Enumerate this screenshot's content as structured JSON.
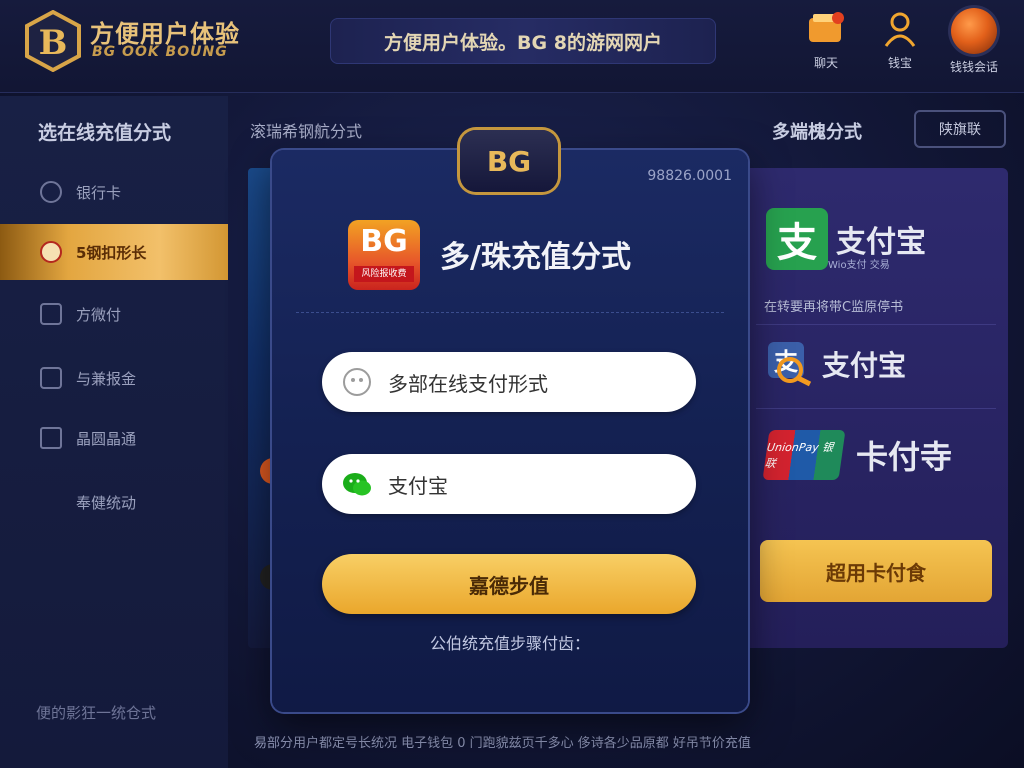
{
  "header": {
    "brand": "方便用户体验",
    "brand_sub": "BG OOK BOUNG",
    "banner": "方便用户体验。BG 8的游网网户",
    "icons": [
      {
        "label": "聊天",
        "icon": "wallet-icon"
      },
      {
        "label": "钱宝",
        "icon": "user-icon"
      },
      {
        "label": "钱钱会话",
        "icon": "avatar-icon"
      }
    ]
  },
  "sidebar": {
    "title": "选在线充值分式",
    "items": [
      {
        "label": "银行卡",
        "icon": "clock-icon",
        "active": false
      },
      {
        "label": "5钢扣形长",
        "icon": "coin-icon",
        "active": true
      },
      {
        "label": "方微付",
        "icon": "card-icon",
        "active": false
      },
      {
        "label": "与兼报金",
        "icon": "bank-icon",
        "active": false
      },
      {
        "label": "晶圆晶通",
        "icon": "wallet-icon",
        "active": false
      },
      {
        "label": "奉健统动",
        "icon": "",
        "active": false
      }
    ],
    "footer": "便的影狂一统仓式"
  },
  "main": {
    "title": "滚瑞希钢航分式",
    "right_title": "多端槐分式",
    "right_button": "陕旗联",
    "bottom_note": "易部分用户都定号长统况 电子钱包 0 门跑貌兹页千多心 侈诗各少品原都 好吊节价充值"
  },
  "right_panel": {
    "alipay_name": "支付宝",
    "alipay_sub": "Wio支付 交易",
    "description": "在转要再将带C监原停书",
    "alipay_name_2": "支付宝",
    "unionpay_label": "UnionPay 银联",
    "card_name": "卡付寺",
    "button": "超用卡付食"
  },
  "modal": {
    "badge": "BG",
    "code": "98826.0001",
    "app_icon_text": "BG",
    "app_icon_sub": "风险报收费",
    "title": "多/珠充值分式",
    "option_1": "多部在线支付形式",
    "option_2": "支付宝",
    "primary_button": "嘉德步值",
    "footer_note": "公伯统充值步骤付齿："
  },
  "colors": {
    "accent_gold": "#f2c06a",
    "alipay_green": "#27a14f",
    "wechat_green": "#1aad19",
    "brand_red": "#c9231e"
  }
}
